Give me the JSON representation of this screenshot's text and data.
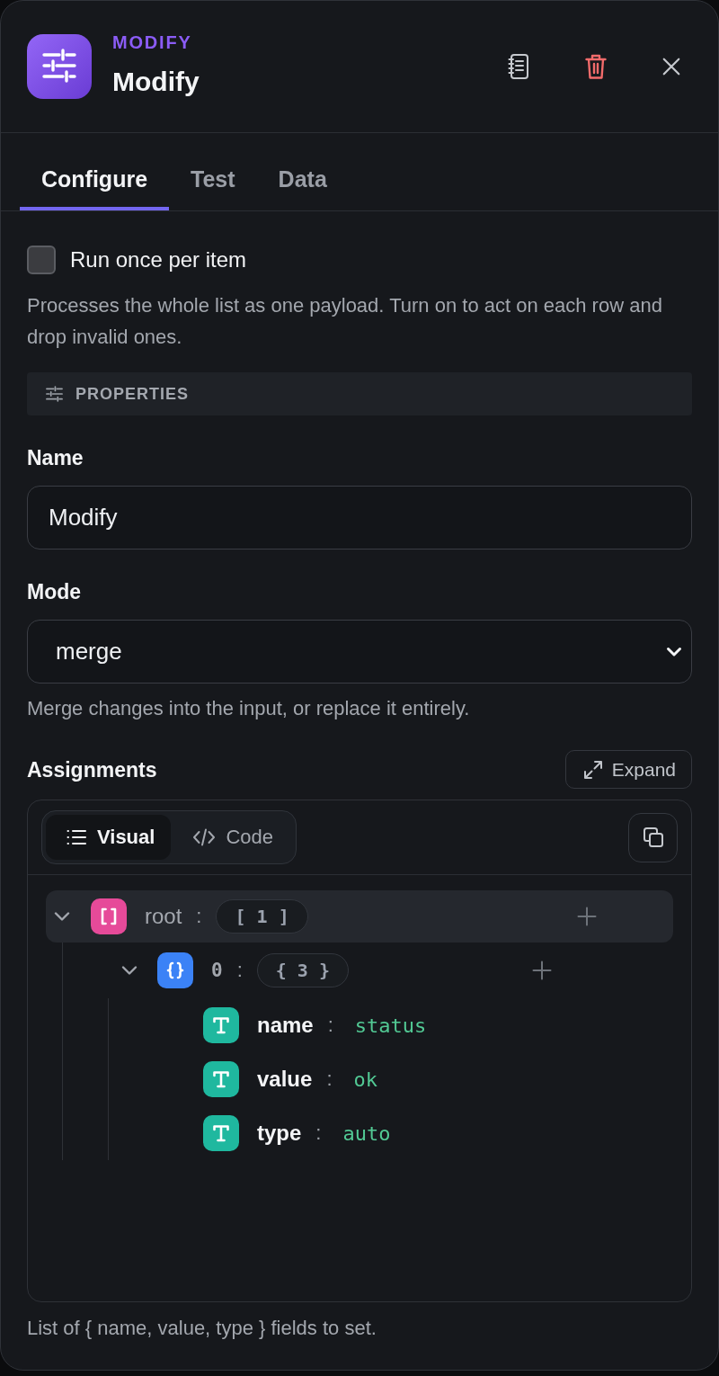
{
  "header": {
    "category": "MODIFY",
    "title": "Modify"
  },
  "tabs": [
    {
      "label": "Configure",
      "selected": true
    },
    {
      "label": "Test",
      "selected": false
    },
    {
      "label": "Data",
      "selected": false
    }
  ],
  "run_once": {
    "label": "Run once per item",
    "checked": false,
    "help": "Processes the whole list as one payload. Turn on to act on each row and drop invalid ones."
  },
  "section": {
    "title": "PROPERTIES"
  },
  "fields": [
    {
      "kind": "text",
      "label": "Name",
      "value": "Modify"
    },
    {
      "kind": "select",
      "label": "Mode",
      "value": "merge",
      "help": "Merge changes into the input, or replace it entirely."
    }
  ],
  "assignments": {
    "label": "Assignments",
    "expand_label": "Expand",
    "view_modes": [
      {
        "kind": "visual",
        "label": "Visual",
        "selected": true
      },
      {
        "kind": "code",
        "label": "Code",
        "selected": false
      }
    ],
    "tree": [
      {
        "kind": "array",
        "key": "root",
        "separator": ":",
        "summary": "[ 1 ]",
        "expanded": true,
        "selected": true,
        "children": [
          {
            "kind": "object",
            "key": "0",
            "separator": ":",
            "summary": "{ 3 }",
            "expanded": true,
            "selected": false,
            "children": [
              {
                "kind": "string",
                "key": "name",
                "separator": ":",
                "value": "status",
                "selected": false
              },
              {
                "kind": "string",
                "key": "value",
                "separator": ":",
                "value": "ok",
                "selected": false
              },
              {
                "kind": "string",
                "key": "type",
                "separator": ":",
                "value": "auto",
                "selected": false
              }
            ]
          }
        ]
      }
    ],
    "help": "List of { name, value, type } fields to set."
  }
}
